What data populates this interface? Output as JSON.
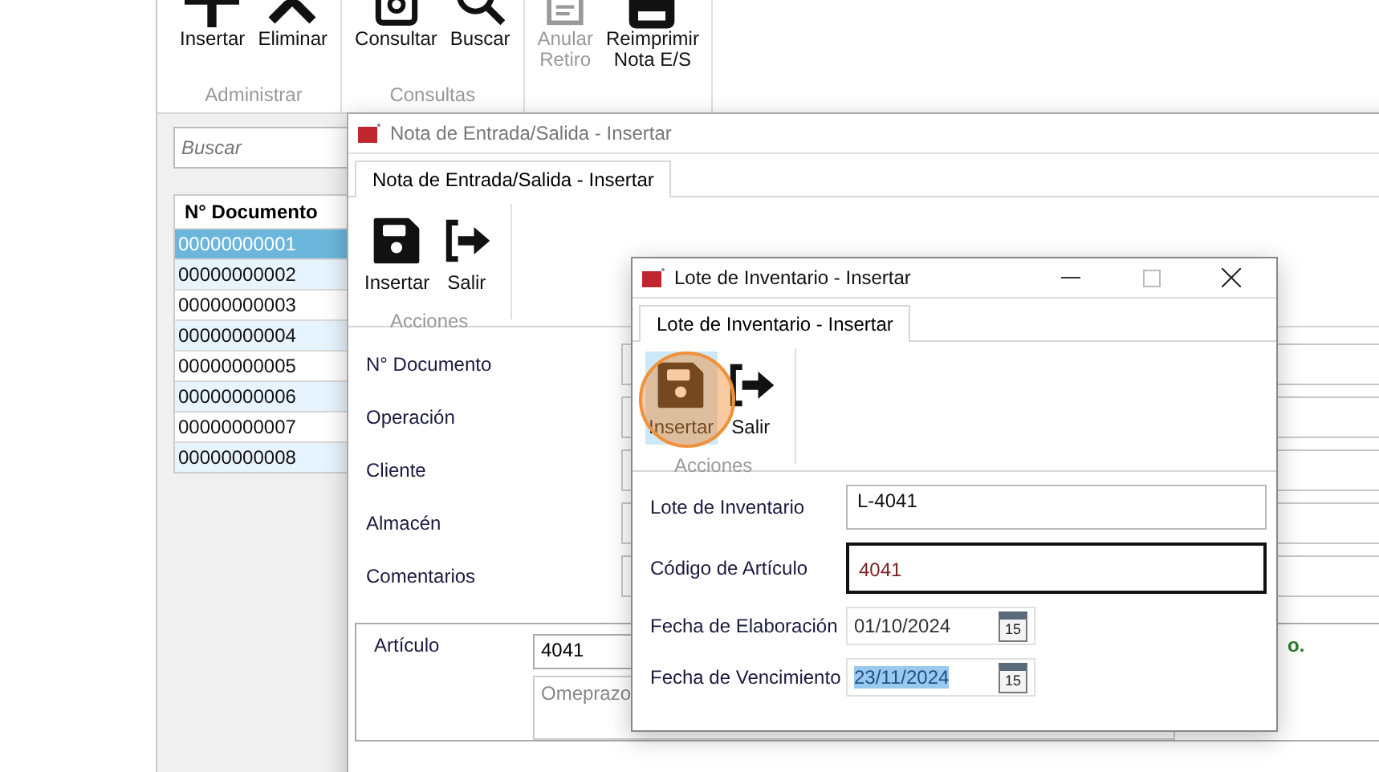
{
  "ribbon": {
    "groups": [
      {
        "label": "Administrar",
        "buttons": [
          {
            "label": "Insertar",
            "disabled": false
          },
          {
            "label": "Eliminar",
            "disabled": false
          }
        ]
      },
      {
        "label": "Consultas",
        "buttons": [
          {
            "label": "Consultar",
            "disabled": false
          },
          {
            "label": "Buscar",
            "disabled": false
          }
        ]
      },
      {
        "buttons": [
          {
            "label": "Anular\nRetiro",
            "disabled": true
          },
          {
            "label": "Reimprimir\nNota E/S",
            "disabled": false
          }
        ]
      }
    ]
  },
  "search": {
    "placeholder": "Buscar"
  },
  "table": {
    "columns": [
      "N° Documento"
    ],
    "rows": [
      {
        "cells": [
          "00000000001"
        ],
        "selected": true
      },
      {
        "cells": [
          "00000000002"
        ],
        "selected": false
      },
      {
        "cells": [
          "00000000003"
        ],
        "selected": false
      },
      {
        "cells": [
          "00000000004"
        ],
        "selected": false
      },
      {
        "cells": [
          "00000000005"
        ],
        "selected": false
      },
      {
        "cells": [
          "00000000006"
        ],
        "selected": false
      },
      {
        "cells": [
          "00000000007"
        ],
        "selected": false
      },
      {
        "cells": [
          "00000000008"
        ],
        "selected": false
      }
    ]
  },
  "nota_window": {
    "title": "Nota de Entrada/Salida - Insertar",
    "tab": "Nota de Entrada/Salida - Insertar",
    "buttons": [
      {
        "label": "Insertar",
        "selected": false
      },
      {
        "label": "Salir",
        "selected": false
      }
    ],
    "group_label": "Acciones",
    "fields": [
      {
        "label": "N° Documento"
      },
      {
        "label": "Operación"
      },
      {
        "label": "Cliente"
      },
      {
        "label": "Almacén"
      },
      {
        "label": "Comentarios"
      }
    ],
    "article": {
      "label": "Artículo",
      "value": "4041",
      "description": "Omeprazo",
      "note": "o."
    }
  },
  "lote_window": {
    "title": "Lote de Inventario - Insertar",
    "tab": "Lote de Inventario - Insertar",
    "buttons": [
      {
        "label": "Insertar",
        "selected": true
      },
      {
        "label": "Salir",
        "selected": false
      }
    ],
    "group_label": "Acciones",
    "fields": [
      {
        "kind": "text",
        "label": "Lote de Inventario",
        "value": "L-4041",
        "focused": false
      },
      {
        "kind": "text",
        "label": "Código de Artículo",
        "value": "4041",
        "focused": true
      },
      {
        "kind": "date",
        "label": "Fecha de Elaboración",
        "value": "01/10/2024",
        "calendar_day": "15",
        "selected": false
      },
      {
        "kind": "date",
        "label": "Fecha de Vencimiento",
        "value": "23/11/2024",
        "calendar_day": "15",
        "selected": true
      }
    ]
  }
}
